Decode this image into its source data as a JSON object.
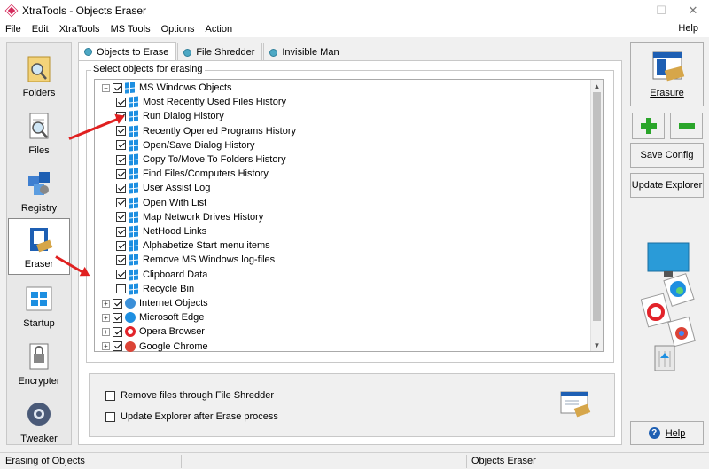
{
  "window": {
    "title": "XtraTools - Objects Eraser",
    "minimize": "—",
    "maximize": "☐",
    "close": "✕"
  },
  "menu": [
    "File",
    "Edit",
    "XtraTools",
    "MS Tools",
    "Options",
    "Action"
  ],
  "menu_help": "Help",
  "sidebar": [
    "Folders",
    "Files",
    "Registry",
    "Eraser",
    "Startup",
    "Encrypter",
    "Tweaker"
  ],
  "tabs": [
    "Objects to Erase",
    "File Shredder",
    "Invisible Man"
  ],
  "group_label": "Select objects for erasing",
  "tree": [
    {
      "label": "MS Windows Objects",
      "checked": true,
      "icon": "windows-icon",
      "level": 0,
      "expanded": true
    },
    {
      "label": "Most Recently Used Files History",
      "checked": true,
      "icon": "windows-icon",
      "level": 1
    },
    {
      "label": "Run Dialog History",
      "checked": true,
      "icon": "windows-icon",
      "level": 1
    },
    {
      "label": "Recently Opened Programs History",
      "checked": true,
      "icon": "windows-icon",
      "level": 1
    },
    {
      "label": "Open/Save Dialog History",
      "checked": true,
      "icon": "windows-icon",
      "level": 1
    },
    {
      "label": "Copy To/Move To Folders History",
      "checked": true,
      "icon": "windows-icon",
      "level": 1
    },
    {
      "label": "Find Files/Computers History",
      "checked": true,
      "icon": "windows-icon",
      "level": 1
    },
    {
      "label": "User Assist Log",
      "checked": true,
      "icon": "windows-icon",
      "level": 1
    },
    {
      "label": "Open With List",
      "checked": true,
      "icon": "windows-icon",
      "level": 1
    },
    {
      "label": "Map Network Drives History",
      "checked": true,
      "icon": "windows-icon",
      "level": 1
    },
    {
      "label": "NetHood Links",
      "checked": true,
      "icon": "windows-icon",
      "level": 1
    },
    {
      "label": "Alphabetize Start menu items",
      "checked": true,
      "icon": "windows-icon",
      "level": 1
    },
    {
      "label": "Remove MS Windows log-files",
      "checked": true,
      "icon": "windows-icon",
      "level": 1
    },
    {
      "label": "Clipboard Data",
      "checked": true,
      "icon": "windows-icon",
      "level": 1
    },
    {
      "label": "Recycle Bin",
      "checked": false,
      "icon": "windows-icon",
      "level": 1
    },
    {
      "label": "Internet Objects",
      "checked": true,
      "icon": "internet-icon",
      "level": 0,
      "expanded": false
    },
    {
      "label": "Microsoft Edge",
      "checked": true,
      "icon": "edge-icon",
      "level": 0,
      "expanded": false
    },
    {
      "label": "Opera Browser",
      "checked": true,
      "icon": "opera-icon",
      "level": 0,
      "expanded": false
    },
    {
      "label": "Google Chrome",
      "checked": true,
      "icon": "chrome-icon",
      "level": 0,
      "expanded": false
    }
  ],
  "options": [
    {
      "label": "Remove files through File Shredder",
      "checked": false
    },
    {
      "label": "Update Explorer after Erase process",
      "checked": false
    }
  ],
  "right": {
    "erasure": "Erasure",
    "save_config": "Save Config",
    "update_explorer": "Update Explorer",
    "help": "Help",
    "add": "+",
    "remove": "−"
  },
  "status": {
    "left": "Erasing of Objects",
    "right": "Objects Eraser"
  },
  "colors": {
    "accent": "#1d8fe1",
    "green": "#2aa52a",
    "arrow": "#e02020"
  }
}
